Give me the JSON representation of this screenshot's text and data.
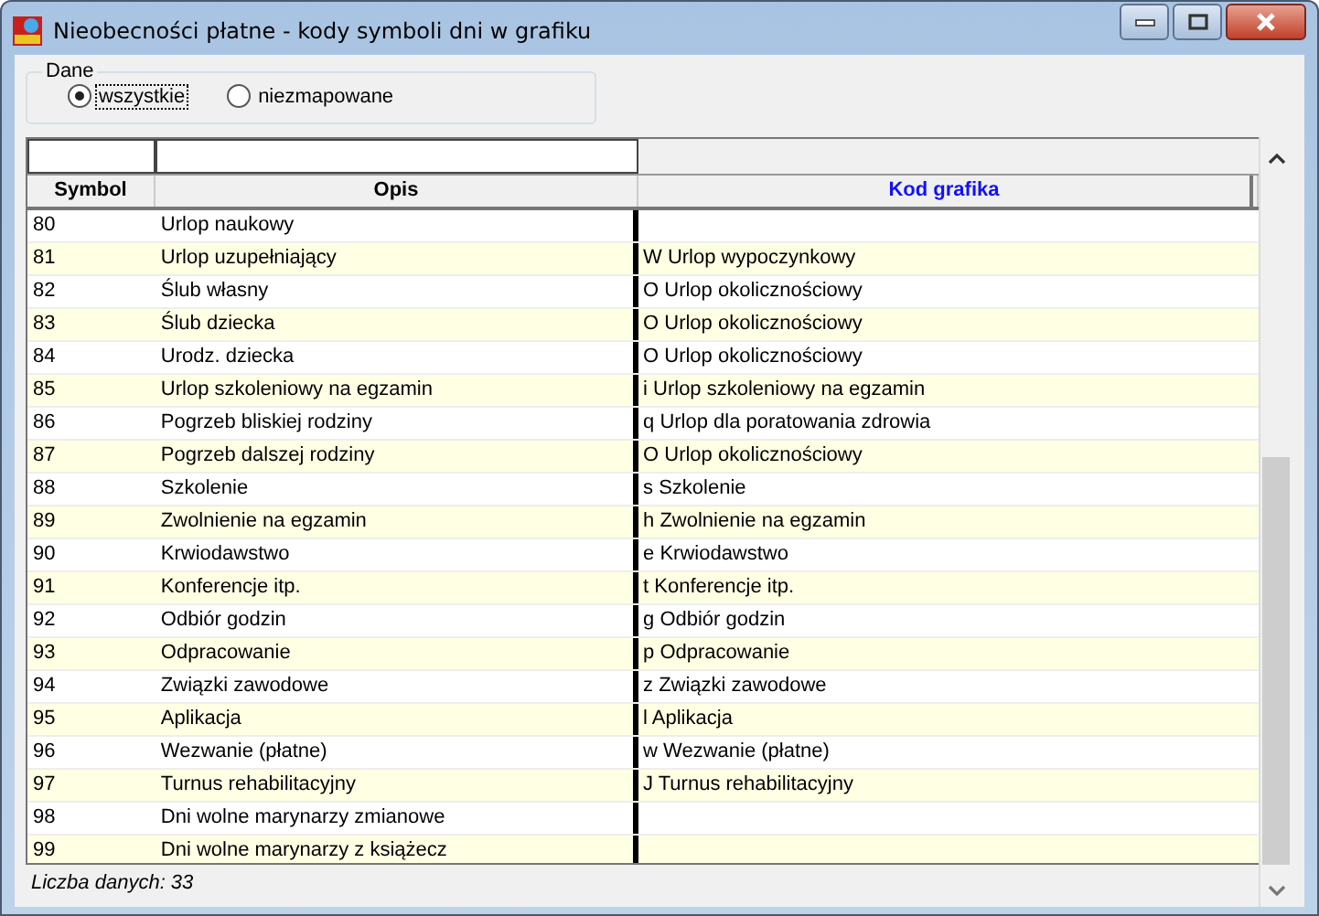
{
  "window": {
    "title": "Nieobecności płatne - kody symboli dni w grafiku"
  },
  "group": {
    "label": "Dane",
    "options": [
      {
        "label": "wszystkie",
        "selected": true
      },
      {
        "label": "niezmapowane",
        "selected": false
      }
    ]
  },
  "table": {
    "columns": [
      "Symbol",
      "Opis",
      "Kod grafika"
    ],
    "rows": [
      {
        "symbol": "80",
        "opis": "Urlop naukowy",
        "kod": ""
      },
      {
        "symbol": "81",
        "opis": "Urlop uzupełniający",
        "kod": "W Urlop wypoczynkowy"
      },
      {
        "symbol": "82",
        "opis": "Ślub własny",
        "kod": "O Urlop okolicznościowy"
      },
      {
        "symbol": "83",
        "opis": "Ślub dziecka",
        "kod": "O Urlop okolicznościowy"
      },
      {
        "symbol": "84",
        "opis": "Urodz. dziecka",
        "kod": "O Urlop okolicznościowy"
      },
      {
        "symbol": "85",
        "opis": "Urlop szkoleniowy na egzamin",
        "kod": "i Urlop szkoleniowy na egzamin"
      },
      {
        "symbol": "86",
        "opis": "Pogrzeb bliskiej rodziny",
        "kod": "q Urlop dla poratowania zdrowia"
      },
      {
        "symbol": "87",
        "opis": "Pogrzeb dalszej rodziny",
        "kod": "O Urlop okolicznościowy"
      },
      {
        "symbol": "88",
        "opis": "Szkolenie",
        "kod": "s Szkolenie"
      },
      {
        "symbol": "89",
        "opis": "Zwolnienie na egzamin",
        "kod": "h Zwolnienie na egzamin"
      },
      {
        "symbol": "90",
        "opis": "Krwiodawstwo",
        "kod": "e Krwiodawstwo"
      },
      {
        "symbol": "91",
        "opis": "Konferencje itp.",
        "kod": "t Konferencje itp."
      },
      {
        "symbol": "92",
        "opis": "Odbiór godzin",
        "kod": "g Odbiór godzin"
      },
      {
        "symbol": "93",
        "opis": "Odpracowanie",
        "kod": "p Odpracowanie"
      },
      {
        "symbol": "94",
        "opis": "Związki zawodowe",
        "kod": "z Związki zawodowe"
      },
      {
        "symbol": "95",
        "opis": "Aplikacja",
        "kod": "l Aplikacja"
      },
      {
        "symbol": "96",
        "opis": "Wezwanie (płatne)",
        "kod": "w Wezwanie (płatne)"
      },
      {
        "symbol": "97",
        "opis": "Turnus rehabilitacyjny",
        "kod": "J Turnus rehabilitacyjny"
      },
      {
        "symbol": "98",
        "opis": "Dni wolne marynarzy zmianowe",
        "kod": ""
      },
      {
        "symbol": "99",
        "opis": "Dni wolne marynarzy z książecz",
        "kod": ""
      }
    ]
  },
  "status_bar": {
    "text": "Liczba danych: 33"
  }
}
